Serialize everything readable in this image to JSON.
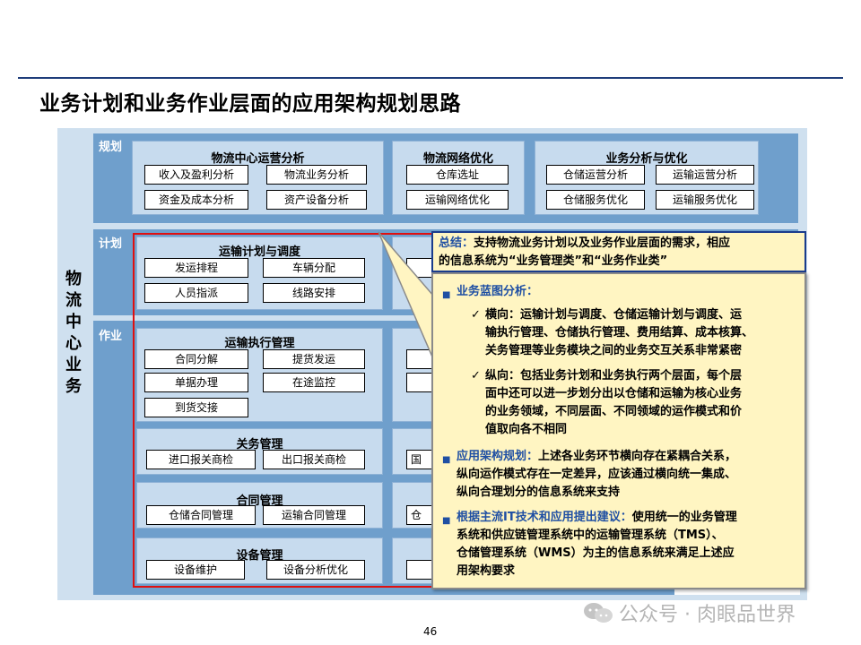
{
  "title": "业务计划和业务作业层面的应用架构规划思路",
  "side_label": [
    "物",
    "流",
    "中",
    "心",
    "业",
    "务"
  ],
  "bands": {
    "planning": "规划",
    "plan": "计划",
    "operation": "作业"
  },
  "planning_panels": [
    {
      "title": "物流中心运营分析",
      "items": [
        "收入及盈利分析",
        "物流业务分析",
        "资金及成本分析",
        "资产设备分析"
      ]
    },
    {
      "title": "物流网络优化",
      "items": [
        "仓库选址",
        "运输网络优化"
      ]
    },
    {
      "title": "业务分析与优化",
      "items": [
        "仓储运营分析",
        "运输运营分析",
        "仓储服务优化",
        "运输服务优化"
      ]
    }
  ],
  "plan_panel": {
    "title": "运输计划与调度",
    "items": [
      "发运排程",
      "车辆分配",
      "人员指派",
      "线路安排"
    ]
  },
  "exec_panel": {
    "title": "运输执行管理",
    "items": [
      "合同分解",
      "提货发运",
      "单据办理",
      "在途监控",
      "到货交接"
    ]
  },
  "customs_panel": {
    "title": "关务管理",
    "items": [
      "进口报关商检",
      "出口报关商检"
    ]
  },
  "contract_panel": {
    "title": "合同管理",
    "items": [
      "仓储合同管理",
      "运输合同管理"
    ]
  },
  "equipment_panel": {
    "title": "设备管理",
    "items": [
      "设备维护",
      "设备分析优化"
    ]
  },
  "partial_chips": [
    "国",
    "仓"
  ],
  "summary": {
    "label": "总结：",
    "text1": "支持物流业务计划以及业务作业层面的需求，相应",
    "text2": "的信息系统为“业务管理类”和“业务作业类”"
  },
  "callout": {
    "b1_title": "业务蓝图分析：",
    "b1_h_lines": [
      "横向：运输计划与调度、仓储运输计划与调度、运",
      "输执行管理、仓储执行管理、费用结算、成本核算、",
      "关务管理等业务模块之间的业务交互关系非常紧密"
    ],
    "b1_v_lines": [
      "纵向：包括业务计划和业务执行两个层面，每个层",
      "面中还可以进一步划分出以仓储和运输为核心业务",
      "的业务领域，不同层面、不同领域的运作模式和价",
      "值取向各不相同"
    ],
    "b2_title": "应用架构规划：",
    "b2_lines": [
      "上述各业务环节横向存在紧耦合关系，",
      "纵向运作模式存在一定差异，应该通过横向统一集成、",
      "纵向合理划分的信息系统来支持"
    ],
    "b3_title": "根据主流IT技术和应用提出建议：",
    "b3_lines": [
      "使用统一的业务管理",
      "系统和供应链管理系统中的运输管理系统（TMS）、",
      "仓储管理系统（WMS）为主的信息系统来满足上述应",
      "用架构要求"
    ]
  },
  "watermark": "公众号 · 肉眼品世界",
  "page_number": "46",
  "colors": {
    "band": "#6f9fcc",
    "panel": "#c7dbee",
    "accent": "#1f4fa3",
    "frame": "#e01010",
    "callout_bg": "#fff5c2"
  }
}
